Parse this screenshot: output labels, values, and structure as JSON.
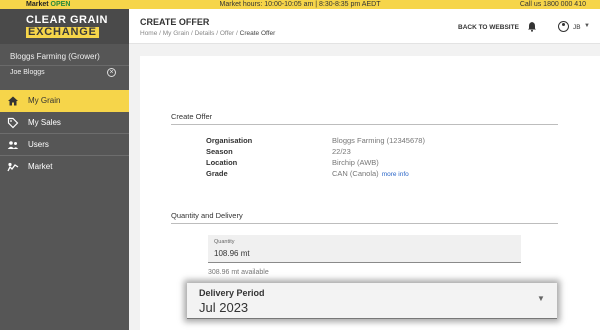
{
  "topbar": {
    "market_label": "Market",
    "market_status": "OPEN",
    "market_hours": "Market hours: 10:00-10:05 am | 8:30-8:35 pm AEDT",
    "call_text": "Call us 1800 000 410"
  },
  "logo": {
    "line1": "CLEAR GRAIN",
    "line2": "EXCHANGE"
  },
  "sidebar": {
    "account_name": "Bloggs Farming (Grower)",
    "user_name": "Joe Bloggs",
    "items": [
      {
        "label": "My Grain",
        "icon": "home-icon",
        "active": true
      },
      {
        "label": "My Sales",
        "icon": "tag-icon",
        "active": false
      },
      {
        "label": "Users",
        "icon": "users-icon",
        "active": false
      },
      {
        "label": "Market",
        "icon": "market-icon",
        "active": false
      }
    ]
  },
  "header": {
    "title": "CREATE OFFER",
    "breadcrumbs": [
      "Home",
      "My Grain",
      "Details",
      "Offer"
    ],
    "breadcrumb_current": "Create Offer",
    "back_link": "BACK TO WEBSITE",
    "user_initials": "JB"
  },
  "offer": {
    "section_title": "Create Offer",
    "rows": [
      {
        "label": "Organisation",
        "value": "Bloggs Farming (12345678)"
      },
      {
        "label": "Season",
        "value": "22/23"
      },
      {
        "label": "Location",
        "value": "Birchip (AWB)"
      },
      {
        "label": "Grade",
        "value": "CAN (Canola)",
        "link": "more info"
      }
    ]
  },
  "quantity": {
    "section_title": "Quantity and Delivery",
    "field_label": "Quantity",
    "field_value": "108.96 mt",
    "available": "308.96 mt available"
  },
  "delivery": {
    "label": "Delivery Period",
    "value": "Jul 2023"
  },
  "colors": {
    "accent": "#f6d54a",
    "sidebar": "#565656",
    "link": "#2a66c8",
    "open": "#2a8a3a"
  }
}
